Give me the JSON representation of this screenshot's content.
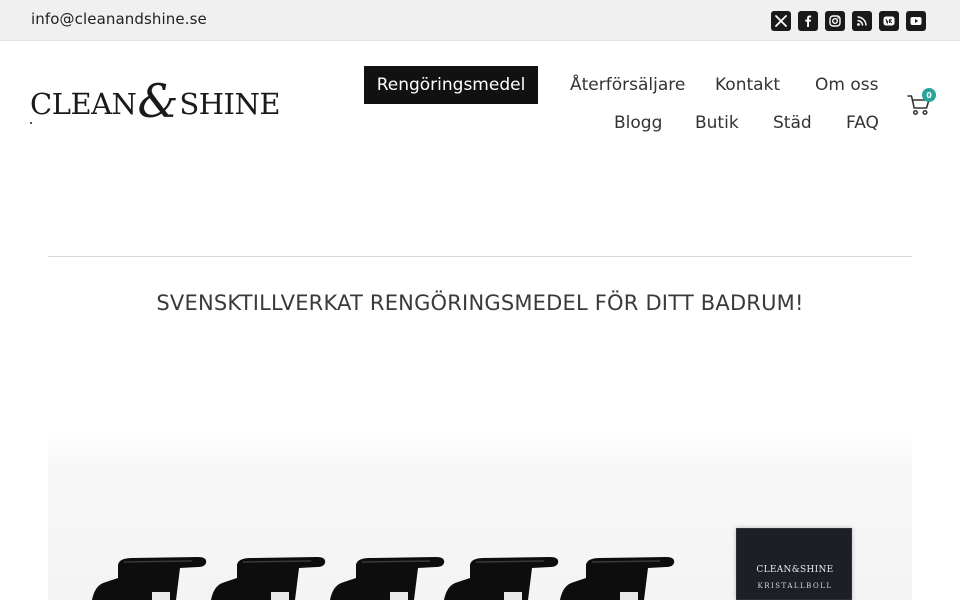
{
  "topbar": {
    "email": "info@cleanandshine.se",
    "socials": [
      {
        "icon": "x-twitter-icon"
      },
      {
        "icon": "facebook-icon"
      },
      {
        "icon": "instagram-icon"
      },
      {
        "icon": "rss-icon"
      },
      {
        "icon": "vk-icon"
      },
      {
        "icon": "youtube-icon"
      }
    ]
  },
  "logo": {
    "word1": "CLEAN",
    "amp": "&",
    "word2": "SHINE"
  },
  "nav": {
    "active": "Rengöringsmedel",
    "aterforsaljare": "Återförsäljare",
    "kontakt": "Kontakt",
    "om_oss": "Om oss",
    "blogg": "Blogg",
    "butik": "Butik",
    "stad": "Städ",
    "faq": "FAQ"
  },
  "cart": {
    "count": "0",
    "icon": "cart-icon",
    "accent": "#2aa49a"
  },
  "main": {
    "headline": "SVENSKTILLVERKAT RENGÖRINGSMEDEL FÖR DITT BADRUM!"
  },
  "product_box": {
    "brand": "CLEAN&SHINE",
    "label": "KRISTALLBOLL"
  }
}
